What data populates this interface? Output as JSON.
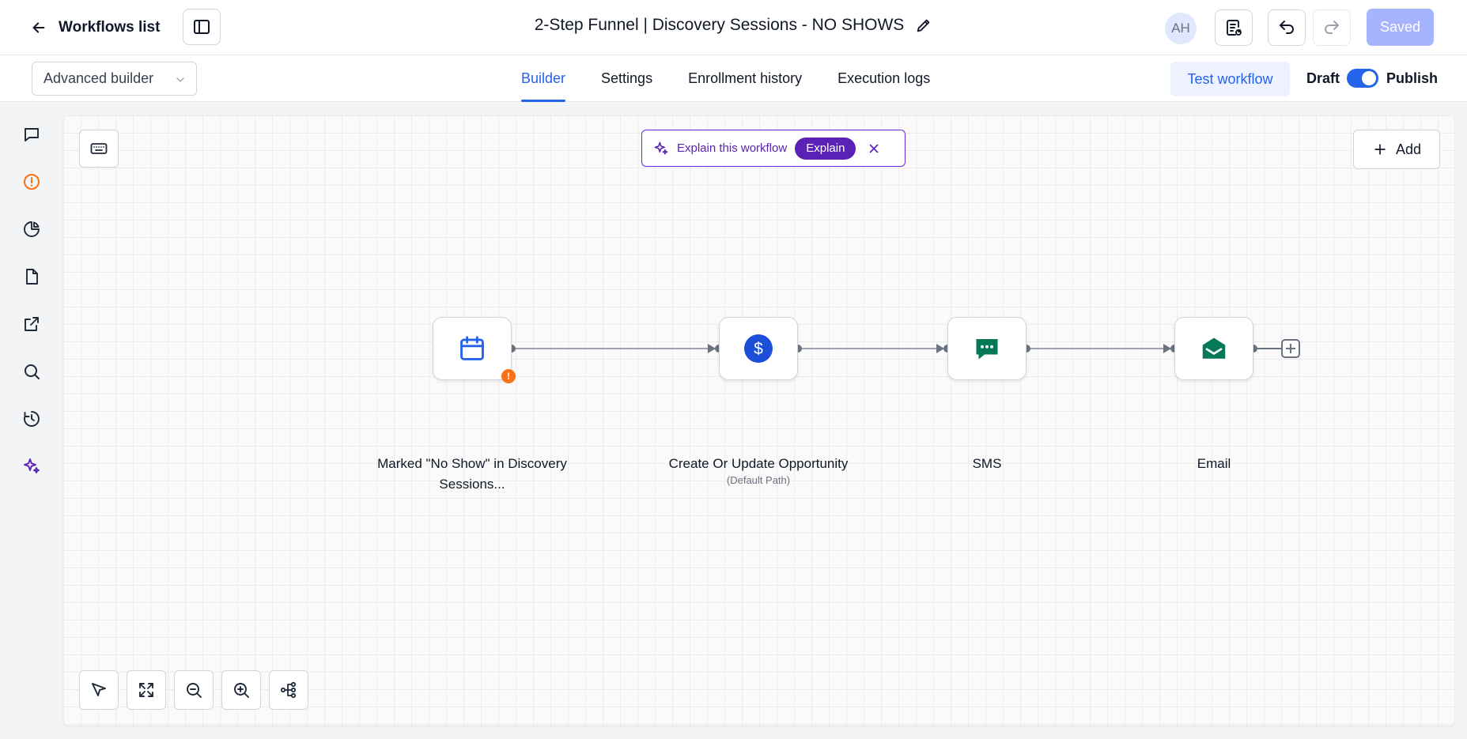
{
  "header": {
    "back_label": "Workflows list",
    "title": "2-Step Funnel | Discovery Sessions - NO SHOWS",
    "avatar_initials": "AH",
    "saved_label": "Saved"
  },
  "subheader": {
    "builder_mode": "Advanced builder",
    "tabs": [
      {
        "label": "Builder",
        "active": true
      },
      {
        "label": "Settings",
        "active": false
      },
      {
        "label": "Enrollment history",
        "active": false
      },
      {
        "label": "Execution logs",
        "active": false
      }
    ],
    "test_label": "Test workflow",
    "draft_label": "Draft",
    "publish_label": "Publish",
    "published": true
  },
  "sidebar": {
    "items": [
      {
        "icon": "chat-icon"
      },
      {
        "icon": "alert-icon",
        "color": "#f97316"
      },
      {
        "icon": "pie-chart-icon"
      },
      {
        "icon": "document-icon"
      },
      {
        "icon": "external-link-icon"
      },
      {
        "icon": "search-icon"
      },
      {
        "icon": "history-icon"
      },
      {
        "icon": "sparkle-icon",
        "color": "#5b21b6"
      }
    ]
  },
  "canvas": {
    "explain_text": "Explain this workflow",
    "explain_button": "Explain",
    "add_label": "Add",
    "nodes": [
      {
        "name": "trigger",
        "label": "Marked \"No Show\" in Discovery Sessions...",
        "sublabel": "",
        "icon": "calendar-icon",
        "warning": true
      },
      {
        "name": "opportunity",
        "label": "Create Or Update Opportunity",
        "sublabel": "(Default Path)",
        "icon": "dollar-icon",
        "warning": false
      },
      {
        "name": "sms",
        "label": "SMS",
        "sublabel": "",
        "icon": "sms-icon",
        "warning": false
      },
      {
        "name": "email",
        "label": "Email",
        "sublabel": "",
        "icon": "email-icon",
        "warning": false
      }
    ],
    "warning_glyph": "!",
    "controls": [
      "select-tool-icon",
      "fit-view-icon",
      "zoom-out-icon",
      "zoom-in-icon",
      "auto-layout-icon"
    ]
  },
  "colors": {
    "accent": "#2563eb",
    "explain_purple": "#5b21b6",
    "warning": "#f97316",
    "sms_green": "#047857",
    "saved_button": "#a5b4fc"
  }
}
